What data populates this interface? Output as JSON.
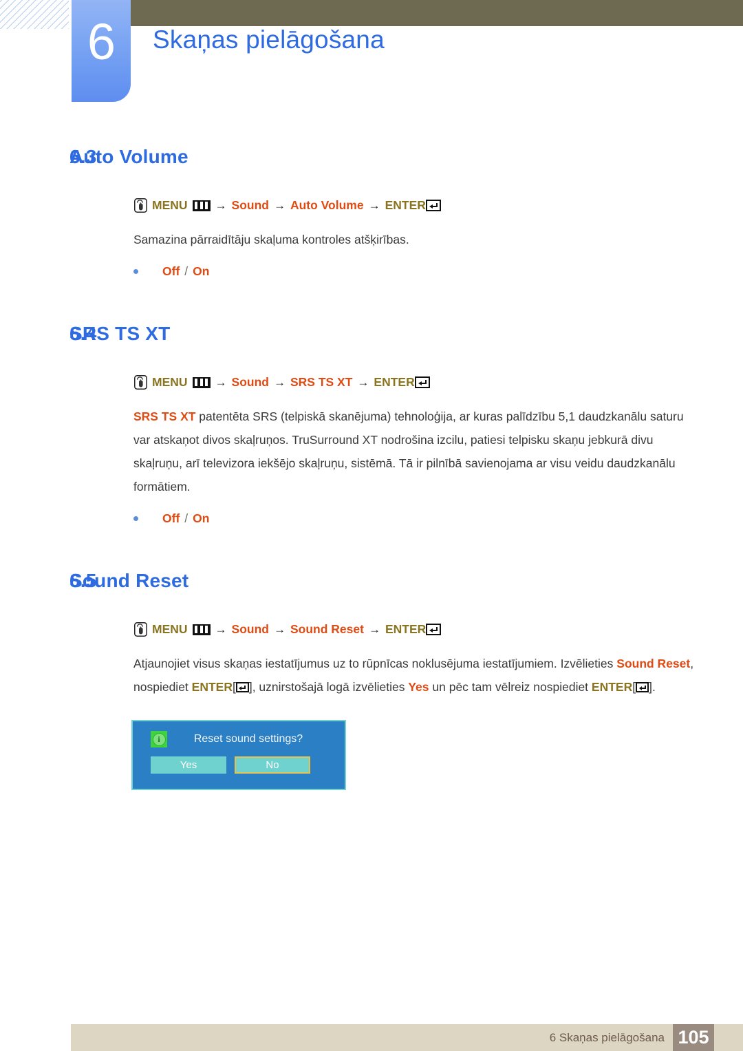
{
  "header": {
    "chapter_number": "6",
    "chapter_title": "Skaņas pielāgošana"
  },
  "colors": {
    "heading_blue": "#2f6be0",
    "menu_olive": "#8a7420",
    "menu_item_orange": "#e04b13",
    "olive_bar": "#6e6a52",
    "footer_bar": "#ddd6c3",
    "footer_pageno_bg": "#9a8b80",
    "osd_bg": "#2b7fc4",
    "osd_border": "#6fd2cf",
    "osd_button": "#6fd2cf",
    "osd_focus": "#e8c24a",
    "osd_info_green": "#3fd33f"
  },
  "sections": [
    {
      "number": "6.3",
      "title": "Auto Volume",
      "menu_path": {
        "menu_label": "MENU",
        "sep": "→",
        "steps": [
          "Sound",
          "Auto Volume"
        ],
        "enter_label": "ENTER"
      },
      "body": "Samazina pārraidītāju skaļuma kontroles atšķirības.",
      "bullet": {
        "options": [
          "Off",
          "On"
        ],
        "separator": "/"
      }
    },
    {
      "number": "6.4",
      "title": "SRS TS XT",
      "menu_path": {
        "menu_label": "MENU",
        "sep": "→",
        "steps": [
          "Sound",
          "SRS TS XT"
        ],
        "enter_label": "ENTER"
      },
      "body_lead": "SRS TS XT",
      "body": " patentēta SRS (telpiskā skanējuma) tehnoloģija, ar kuras palīdzību 5,1 daudzkanālu saturu var atskaņot divos skaļruņos. TruSurround XT nodrošina izcilu, patiesi telpisku skaņu jebkurā divu skaļruņu, arī televizora iekšējo skaļruņu, sistēmā. Tā ir pilnībā savienojama ar visu veidu daudzkanālu formātiem.",
      "bullet": {
        "options": [
          "Off",
          "On"
        ],
        "separator": "/"
      }
    },
    {
      "number": "6.5",
      "title": "Sound Reset",
      "menu_path": {
        "menu_label": "MENU",
        "sep": "→",
        "steps": [
          "Sound",
          "Sound Reset"
        ],
        "enter_label": "ENTER"
      },
      "body_parts": {
        "t1": "Atjaunojiet visus skaņas iestatījumus uz to rūpnīcas noklusējuma iestatījumiem. Izvēlieties ",
        "hl1": "Sound Reset",
        "t2": ", nospiediet ",
        "kw1": "ENTER",
        "t3": "[",
        "t4": "], uznirstošajā logā izvēlieties ",
        "hl2": "Yes",
        "t5": " un pēc tam vēlreiz nospiediet ",
        "kw2": "ENTER",
        "t6": "[",
        "t7": "]."
      }
    }
  ],
  "osd_dialog": {
    "message": "Reset sound settings?",
    "info_glyph": "i",
    "buttons": [
      {
        "label": "Yes",
        "focused": false
      },
      {
        "label": "No",
        "focused": true
      }
    ]
  },
  "footer": {
    "label": "6 Skaņas pielāgošana",
    "page_number": "105"
  }
}
